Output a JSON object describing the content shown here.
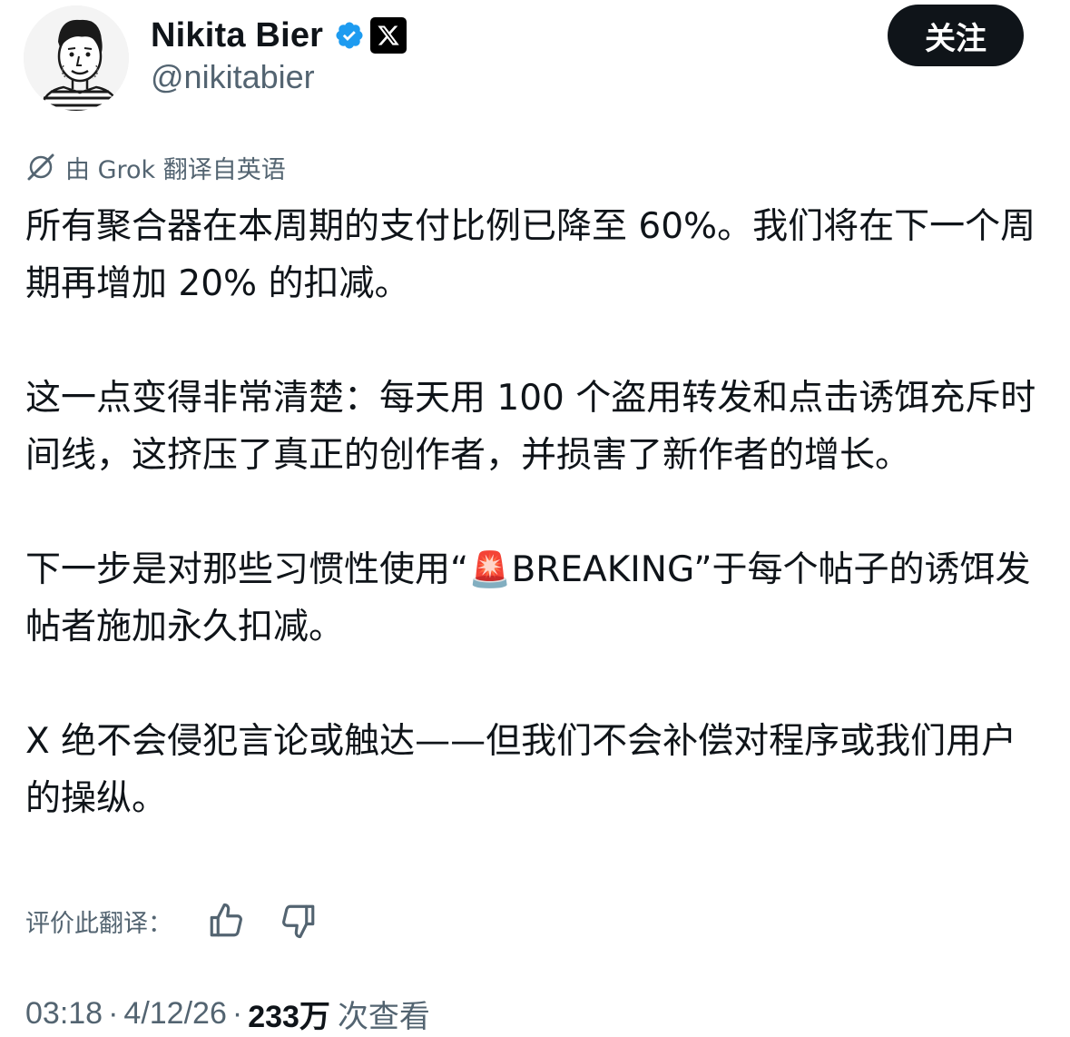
{
  "author": {
    "display_name": "Nikita Bier",
    "handle": "@nikitabier",
    "verified": true,
    "badge_color": "#1d9bf0",
    "affiliation_badge_icon": "x-logo-icon"
  },
  "follow_button": {
    "label": "关注"
  },
  "translation": {
    "label": "由 Grok 翻译自英语",
    "icon": "grok-icon"
  },
  "tweet": {
    "paragraphs": [
      "所有聚合器在本周期的支付比例已降至 60%。我们将在下一个周期再增加 20% 的扣减。",
      "这一点变得非常清楚：每天用 100 个盗用转发和点击诱饵充斥时间线，这挤压了真正的创作者，并损害了新作者的增长。",
      "X 绝不会侵犯言论或触达——但我们不会补偿对程序或我们用户的操纵。"
    ],
    "paragraph_breaking": {
      "before": "下一步是对那些习惯性使用“",
      "emoji": "🚨",
      "after": "BREAKING”于每个帖子的诱饵发帖者施加永久扣减。"
    }
  },
  "rating": {
    "label": "评价此翻译："
  },
  "meta": {
    "time": "03:18",
    "date": "4/12/26",
    "views_count": "233万",
    "views_label": "次查看"
  }
}
